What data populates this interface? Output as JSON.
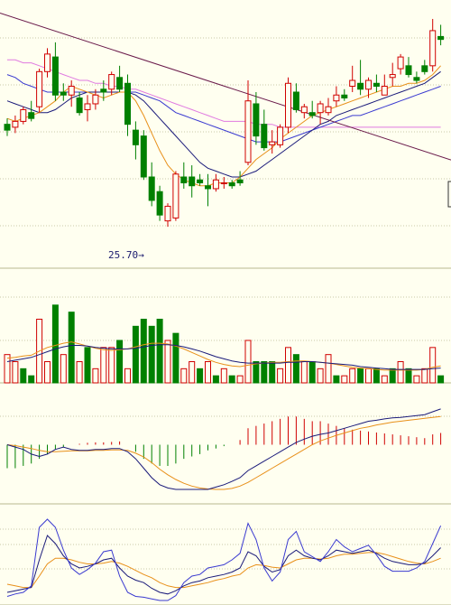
{
  "colors": {
    "background": "#fffff0",
    "grid": "#c8c8a8",
    "panel_line": "#b9b98f",
    "up": "#d00000",
    "down": "#008000",
    "ma_orange": "#e8901a",
    "ma_navy": "#1a1a7a",
    "ma_blue": "#3a3ad0",
    "ma_pink": "#e07ae0",
    "ma_green": "#3c7a3c",
    "trendline": "#6a1a4a",
    "annotation": "#1a1a6e"
  },
  "annotation": {
    "text": "25.70→"
  },
  "chart_data": [
    {
      "type": "candlestick",
      "panel": "price",
      "ylim": [
        24.5,
        33.2
      ],
      "low_marker": 25.7,
      "ohlc": [
        [
          29.2,
          29.4,
          28.8,
          29.0
        ],
        [
          29.1,
          29.5,
          28.9,
          29.3
        ],
        [
          29.3,
          29.8,
          29.2,
          29.7
        ],
        [
          29.6,
          30.0,
          29.3,
          29.4
        ],
        [
          29.8,
          31.1,
          29.6,
          31.0
        ],
        [
          31.0,
          31.8,
          30.8,
          31.6
        ],
        [
          31.5,
          32.0,
          30.0,
          30.2
        ],
        [
          30.3,
          30.6,
          30.0,
          30.2
        ],
        [
          30.2,
          30.7,
          29.8,
          30.5
        ],
        [
          30.1,
          30.3,
          29.5,
          29.6
        ],
        [
          29.7,
          30.2,
          29.3,
          29.9
        ],
        [
          29.9,
          30.4,
          29.7,
          30.2
        ],
        [
          30.4,
          30.7,
          30.0,
          30.3
        ],
        [
          30.4,
          31.0,
          30.2,
          30.9
        ],
        [
          30.8,
          31.2,
          30.3,
          30.4
        ],
        [
          30.6,
          30.9,
          28.8,
          29.2
        ],
        [
          29.0,
          29.3,
          28.0,
          28.5
        ],
        [
          28.8,
          29.0,
          27.3,
          27.4
        ],
        [
          27.4,
          27.9,
          26.4,
          26.6
        ],
        [
          26.9,
          27.1,
          25.9,
          26.1
        ],
        [
          25.9,
          26.5,
          25.7,
          26.4
        ],
        [
          26.0,
          27.6,
          25.9,
          27.5
        ],
        [
          27.4,
          27.9,
          27.0,
          27.2
        ],
        [
          27.4,
          27.8,
          26.7,
          27.1
        ],
        [
          27.3,
          27.5,
          27.1,
          27.2
        ],
        [
          27.1,
          27.5,
          26.4,
          27.0
        ],
        [
          27.0,
          27.5,
          26.9,
          27.3
        ],
        [
          27.2,
          27.4,
          27.0,
          27.2
        ],
        [
          27.2,
          27.3,
          27.0,
          27.1
        ],
        [
          27.3,
          27.6,
          27.1,
          27.2
        ],
        [
          27.9,
          30.7,
          27.8,
          30.0
        ],
        [
          29.9,
          30.3,
          28.5,
          28.8
        ],
        [
          29.2,
          29.7,
          28.3,
          28.4
        ],
        [
          28.5,
          29.0,
          28.2,
          28.6
        ],
        [
          28.5,
          29.2,
          28.4,
          29.1
        ],
        [
          29.1,
          30.8,
          28.9,
          30.6
        ],
        [
          30.3,
          30.6,
          29.6,
          29.7
        ],
        [
          29.6,
          29.9,
          29.4,
          29.8
        ],
        [
          29.6,
          30.0,
          29.4,
          29.5
        ],
        [
          29.6,
          30.0,
          29.2,
          29.9
        ],
        [
          29.6,
          30.1,
          29.5,
          29.8
        ],
        [
          30.0,
          30.5,
          29.8,
          30.2
        ],
        [
          30.2,
          30.4,
          30.0,
          30.1
        ],
        [
          30.5,
          31.2,
          30.3,
          30.7
        ],
        [
          30.6,
          31.4,
          30.2,
          30.4
        ],
        [
          30.4,
          30.8,
          30.1,
          30.7
        ],
        [
          30.6,
          30.9,
          30.3,
          30.5
        ],
        [
          30.2,
          30.9,
          30.2,
          30.5
        ],
        [
          30.8,
          31.3,
          30.5,
          30.9
        ],
        [
          31.1,
          31.6,
          30.9,
          31.5
        ],
        [
          31.2,
          31.5,
          30.8,
          30.9
        ],
        [
          30.8,
          31.0,
          30.6,
          30.7
        ],
        [
          31.2,
          31.4,
          30.9,
          31.0
        ],
        [
          31.2,
          32.8,
          31.0,
          32.4
        ],
        [
          32.2,
          32.6,
          31.9,
          32.1
        ]
      ],
      "ma_short": [
        29.4,
        29.3,
        29.4,
        29.5,
        29.6,
        29.8,
        30.0,
        30.3,
        30.5,
        30.4,
        30.3,
        30.2,
        30.1,
        30.2,
        30.3,
        30.3,
        30.0,
        29.5,
        28.9,
        28.3,
        27.8,
        27.5,
        27.3,
        27.2,
        27.1,
        27.1,
        27.2,
        27.2,
        27.2,
        27.4,
        27.7,
        28.0,
        28.2,
        28.4,
        28.7,
        28.9,
        29.1,
        29.3,
        29.5,
        29.6,
        29.7,
        29.8,
        29.9,
        30.0,
        30.1,
        30.2,
        30.3,
        30.4,
        30.5,
        30.5,
        30.6,
        30.6,
        30.7,
        30.9,
        31.2
      ],
      "ma_mid": [
        30.0,
        29.9,
        29.8,
        29.7,
        29.6,
        29.6,
        29.7,
        29.9,
        30.1,
        30.2,
        30.3,
        30.3,
        30.3,
        30.3,
        30.3,
        30.3,
        30.2,
        30.0,
        29.7,
        29.4,
        29.1,
        28.8,
        28.5,
        28.2,
        27.9,
        27.7,
        27.6,
        27.5,
        27.4,
        27.4,
        27.5,
        27.6,
        27.8,
        28.0,
        28.2,
        28.4,
        28.6,
        28.8,
        29.0,
        29.2,
        29.3,
        29.5,
        29.6,
        29.7,
        29.8,
        29.9,
        30.0,
        30.1,
        30.2,
        30.3,
        30.4,
        30.5,
        30.6,
        30.8,
        31.0
      ],
      "ma_long": [
        30.9,
        30.8,
        30.6,
        30.5,
        30.4,
        30.3,
        30.3,
        30.3,
        30.3,
        30.3,
        30.3,
        30.3,
        30.3,
        30.3,
        30.3,
        30.3,
        30.3,
        30.2,
        30.1,
        30.0,
        29.8,
        29.6,
        29.5,
        29.4,
        29.3,
        29.2,
        29.1,
        29.0,
        28.9,
        28.8,
        28.7,
        28.6,
        28.6,
        28.6,
        28.6,
        28.7,
        28.8,
        28.9,
        29.0,
        29.1,
        29.2,
        29.3,
        29.4,
        29.5,
        29.5,
        29.6,
        29.7,
        29.8,
        29.9,
        30.0,
        30.1,
        30.2,
        30.3,
        30.4,
        30.5
      ],
      "ma_slow": [
        31.4,
        31.4,
        31.3,
        31.3,
        31.2,
        31.1,
        31.0,
        30.9,
        30.8,
        30.7,
        30.7,
        30.6,
        30.6,
        30.5,
        30.5,
        30.4,
        30.4,
        30.3,
        30.2,
        30.1,
        30.0,
        29.9,
        29.8,
        29.7,
        29.6,
        29.5,
        29.4,
        29.3,
        29.3,
        29.3,
        29.3,
        29.2,
        29.2,
        29.2,
        29.1,
        29.1,
        29.1,
        29.1,
        29.1,
        29.1,
        29.1,
        29.1,
        29.1,
        29.1,
        29.1,
        29.1,
        29.1,
        29.1,
        29.1,
        29.1,
        29.1,
        29.1,
        29.1,
        29.1,
        29.1
      ],
      "trendline": [
        [
          0,
          33.0
        ],
        [
          54,
          28.6
        ]
      ]
    },
    {
      "type": "bar",
      "panel": "volume",
      "ylim": [
        0,
        12
      ],
      "values": [
        4,
        3,
        2,
        1,
        9,
        3,
        11,
        4,
        10,
        3,
        5,
        2,
        5,
        5,
        6,
        2,
        8,
        9,
        8,
        9,
        6,
        7,
        2,
        3,
        2,
        3,
        1,
        2,
        1,
        1,
        6,
        3,
        3,
        3,
        2,
        5,
        4,
        3,
        3,
        2,
        4,
        1,
        1,
        2,
        2,
        2,
        2,
        1,
        2,
        3,
        2,
        1,
        2,
        5,
        1
      ],
      "ma_a": [
        3.5,
        3.6,
        3.8,
        3.9,
        4.5,
        5.0,
        5.3,
        5.6,
        5.8,
        5.5,
        5.2,
        4.9,
        4.7,
        4.6,
        4.7,
        4.8,
        5.1,
        5.4,
        5.6,
        5.6,
        5.5,
        5.2,
        4.8,
        4.3,
        3.8,
        3.3,
        2.9,
        2.6,
        2.4,
        2.3,
        2.5,
        2.7,
        2.8,
        2.9,
        2.9,
        3.0,
        3.1,
        3.1,
        3.0,
        2.9,
        2.8,
        2.6,
        2.4,
        2.2,
        2.1,
        2.0,
        1.9,
        1.8,
        1.8,
        1.8,
        1.8,
        1.8,
        1.9,
        2.2,
        2.4
      ],
      "ma_b": [
        3.0,
        3.2,
        3.4,
        3.6,
        4.0,
        4.4,
        4.8,
        5.1,
        5.3,
        5.3,
        5.2,
        5.0,
        4.9,
        4.8,
        4.8,
        4.8,
        4.9,
        5.1,
        5.3,
        5.4,
        5.4,
        5.3,
        5.1,
        4.8,
        4.5,
        4.1,
        3.7,
        3.4,
        3.1,
        2.9,
        2.8,
        2.8,
        2.8,
        2.8,
        2.8,
        2.9,
        2.9,
        3.0,
        3.0,
        2.9,
        2.8,
        2.7,
        2.6,
        2.5,
        2.3,
        2.2,
        2.1,
        2.0,
        1.9,
        1.9,
        1.9,
        1.9,
        1.9,
        2.0,
        2.1
      ],
      "up_flags": [
        1,
        1,
        0,
        0,
        1,
        1,
        0,
        1,
        0,
        1,
        0,
        1,
        1,
        1,
        0,
        1,
        0,
        0,
        0,
        0,
        1,
        0,
        1,
        1,
        0,
        1,
        0,
        1,
        0,
        1,
        1,
        0,
        0,
        0,
        1,
        1,
        0,
        1,
        0,
        1,
        1,
        0,
        1,
        1,
        0,
        1,
        0,
        1,
        0,
        1,
        0,
        1,
        1,
        1,
        0
      ]
    },
    {
      "type": "macd",
      "panel": "macd",
      "ylim": [
        -1.2,
        1.2
      ],
      "hist": [
        -0.5,
        -0.5,
        -0.45,
        -0.4,
        -0.3,
        -0.2,
        -0.1,
        -0.05,
        0.0,
        0.02,
        0.04,
        0.05,
        0.05,
        0.06,
        0.07,
        0.0,
        -0.15,
        -0.3,
        -0.4,
        -0.45,
        -0.45,
        -0.4,
        -0.3,
        -0.25,
        -0.2,
        -0.12,
        -0.08,
        -0.03,
        0.0,
        0.1,
        0.35,
        0.4,
        0.45,
        0.5,
        0.55,
        0.6,
        0.6,
        0.55,
        0.5,
        0.5,
        0.45,
        0.4,
        0.35,
        0.32,
        0.3,
        0.28,
        0.26,
        0.24,
        0.22,
        0.2,
        0.18,
        0.16,
        0.14,
        0.22,
        0.25
      ],
      "dif": [
        0.0,
        -0.05,
        -0.1,
        -0.2,
        -0.25,
        -0.2,
        -0.1,
        -0.05,
        -0.1,
        -0.12,
        -0.12,
        -0.1,
        -0.1,
        -0.08,
        -0.08,
        -0.15,
        -0.3,
        -0.5,
        -0.7,
        -0.85,
        -0.92,
        -0.95,
        -0.95,
        -0.95,
        -0.95,
        -0.95,
        -0.9,
        -0.85,
        -0.78,
        -0.7,
        -0.55,
        -0.45,
        -0.35,
        -0.25,
        -0.15,
        -0.05,
        0.05,
        0.12,
        0.18,
        0.22,
        0.25,
        0.3,
        0.35,
        0.4,
        0.45,
        0.5,
        0.52,
        0.55,
        0.57,
        0.58,
        0.6,
        0.62,
        0.64,
        0.7,
        0.76
      ],
      "dea": [
        0.0,
        -0.02,
        -0.05,
        -0.08,
        -0.12,
        -0.15,
        -0.15,
        -0.14,
        -0.13,
        -0.13,
        -0.13,
        -0.12,
        -0.12,
        -0.11,
        -0.11,
        -0.12,
        -0.18,
        -0.26,
        -0.38,
        -0.52,
        -0.64,
        -0.74,
        -0.82,
        -0.88,
        -0.92,
        -0.94,
        -0.95,
        -0.95,
        -0.93,
        -0.88,
        -0.8,
        -0.7,
        -0.6,
        -0.5,
        -0.4,
        -0.3,
        -0.2,
        -0.1,
        0.0,
        0.08,
        0.14,
        0.2,
        0.25,
        0.3,
        0.35,
        0.38,
        0.42,
        0.45,
        0.48,
        0.5,
        0.52,
        0.54,
        0.56,
        0.58,
        0.6
      ]
    },
    {
      "type": "line",
      "panel": "kdj",
      "ylim": [
        0,
        100
      ],
      "k": [
        10,
        12,
        14,
        16,
        50,
        80,
        70,
        55,
        45,
        40,
        42,
        45,
        50,
        52,
        40,
        30,
        25,
        22,
        15,
        10,
        8,
        12,
        18,
        22,
        24,
        28,
        30,
        32,
        35,
        40,
        60,
        55,
        42,
        35,
        38,
        55,
        62,
        55,
        52,
        50,
        55,
        62,
        60,
        58,
        60,
        62,
        58,
        52,
        48,
        46,
        44,
        44,
        46,
        55,
        65
      ],
      "d": [
        20,
        18,
        16,
        16,
        30,
        45,
        52,
        52,
        50,
        47,
        45,
        45,
        46,
        48,
        46,
        42,
        37,
        32,
        28,
        22,
        18,
        16,
        16,
        18,
        20,
        22,
        25,
        27,
        30,
        32,
        40,
        44,
        43,
        41,
        40,
        45,
        50,
        52,
        52,
        51,
        52,
        55,
        57,
        57,
        58,
        59,
        59,
        57,
        54,
        51,
        48,
        46,
        45,
        48,
        52
      ],
      "j": [
        5,
        8,
        10,
        18,
        90,
        100,
        90,
        62,
        40,
        32,
        38,
        46,
        60,
        62,
        30,
        10,
        5,
        4,
        2,
        0,
        0,
        6,
        22,
        30,
        32,
        40,
        42,
        44,
        50,
        58,
        95,
        75,
        40,
        24,
        35,
        75,
        85,
        60,
        54,
        48,
        60,
        75,
        66,
        60,
        64,
        68,
        56,
        42,
        36,
        36,
        36,
        40,
        48,
        70,
        92
      ]
    }
  ]
}
